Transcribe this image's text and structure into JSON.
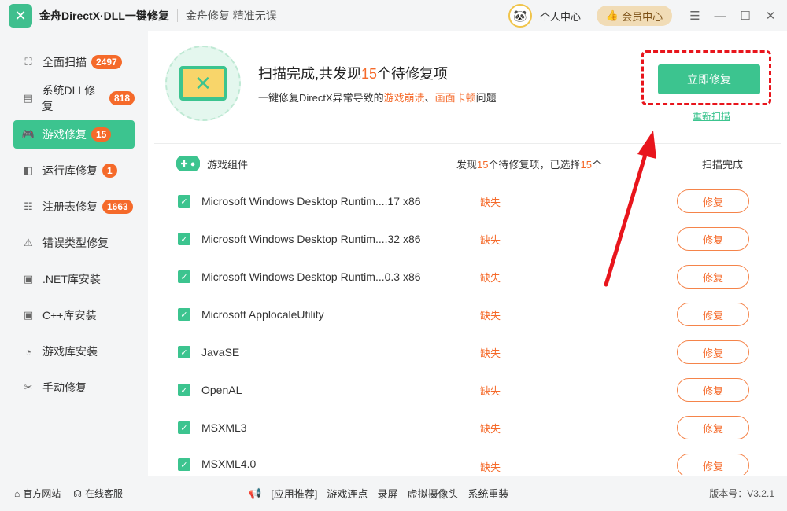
{
  "titlebar": {
    "app_title": "金舟DirectX·DLL一键修复",
    "slogan": "金舟修复 精准无误",
    "personal_label": "个人中心",
    "vip_label": "会员中心"
  },
  "sidebar": {
    "items": [
      {
        "label": "全面扫描",
        "badge": "2497",
        "icon": "scan-icon"
      },
      {
        "label": "系统DLL修复",
        "badge": "818",
        "icon": "dll-icon"
      },
      {
        "label": "游戏修复",
        "badge": "15",
        "icon": "gamepad-icon"
      },
      {
        "label": "运行库修复",
        "badge": "1",
        "icon": "vs-icon"
      },
      {
        "label": "注册表修复",
        "badge": "1663",
        "icon": "list-icon"
      },
      {
        "label": "错误类型修复",
        "badge": "",
        "icon": "warning-icon"
      },
      {
        "label": ".NET库安装",
        "badge": "",
        "icon": "net-icon"
      },
      {
        "label": "C++库安装",
        "badge": "",
        "icon": "cpp-icon"
      },
      {
        "label": "游戏库安装",
        "badge": "",
        "icon": "pacman-icon"
      },
      {
        "label": "手动修复",
        "badge": "",
        "icon": "tools-icon"
      }
    ]
  },
  "scan": {
    "title_prefix": "扫描完成,共发现",
    "count": "15",
    "title_suffix": "个待修复项",
    "sub_prefix": "一键修复DirectX异常导致的",
    "sub_hl1": "游戏崩溃",
    "sub_sep": "、",
    "sub_hl2": "画面卡顿",
    "sub_suffix": "问题",
    "fix_now_label": "立即修复",
    "rescan_label": "重新扫描"
  },
  "list": {
    "group_label": "游戏组件",
    "found_prefix": "发现",
    "found_count": "15",
    "found_mid": "个待修复项，已选择",
    "selected_count": "15",
    "found_suffix": "个",
    "status_head": "扫描完成",
    "rows": [
      {
        "name": "Microsoft Windows Desktop Runtim....17 x86",
        "status": "缺失",
        "action": "修复"
      },
      {
        "name": "Microsoft Windows Desktop Runtim....32 x86",
        "status": "缺失",
        "action": "修复"
      },
      {
        "name": "Microsoft Windows Desktop Runtim...0.3 x86",
        "status": "缺失",
        "action": "修复"
      },
      {
        "name": "Microsoft ApplocaleUtility",
        "status": "缺失",
        "action": "修复"
      },
      {
        "name": "JavaSE",
        "status": "缺失",
        "action": "修复"
      },
      {
        "name": "OpenAL",
        "status": "缺失",
        "action": "修复"
      },
      {
        "name": "MSXML3",
        "status": "缺失",
        "action": "修复"
      },
      {
        "name": "MSXML4.0",
        "status": "缺失",
        "action": "修复"
      }
    ]
  },
  "footer": {
    "official_site": "官方网站",
    "online_service": "在线客服",
    "recommend_label": "[应用推荐]",
    "links": [
      "游戏连点",
      "录屏",
      "虚拟摄像头",
      "系统重装"
    ],
    "version": "版本号：V3.2.1"
  },
  "colors": {
    "accent": "#3cc48f",
    "warning": "#f56a2a",
    "highlight_red": "#e8151c"
  }
}
